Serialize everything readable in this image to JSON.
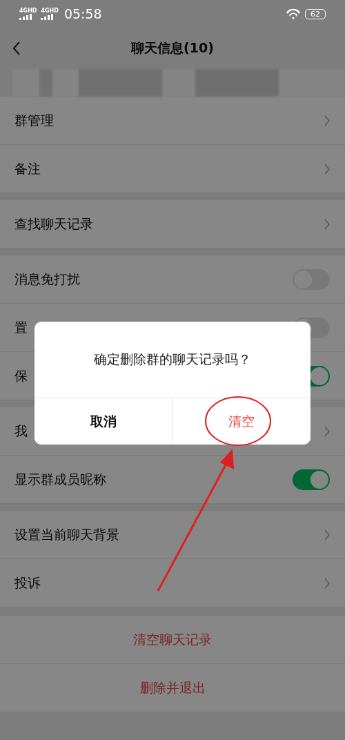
{
  "status_bar": {
    "signals": [
      {
        "label": "4GHD"
      },
      {
        "label": "4GHD"
      }
    ],
    "time": "05:58",
    "battery": "62"
  },
  "nav": {
    "title": "聊天信息(10)"
  },
  "sections": [
    [
      {
        "kind": "link",
        "label": "群管理"
      },
      {
        "kind": "link",
        "label": "备注"
      }
    ],
    [
      {
        "kind": "link",
        "label": "查找聊天记录"
      }
    ],
    [
      {
        "kind": "toggle",
        "label": "消息免打扰",
        "on": false
      },
      {
        "kind": "toggle",
        "label": "置",
        "on": false
      },
      {
        "kind": "toggle",
        "label": "保",
        "on": true
      }
    ],
    [
      {
        "kind": "link",
        "label": "我"
      },
      {
        "kind": "toggle",
        "label": "显示群成员昵称",
        "on": true
      }
    ],
    [
      {
        "kind": "link",
        "label": "设置当前聊天背景"
      },
      {
        "kind": "link",
        "label": "投诉"
      }
    ]
  ],
  "actions": [
    "清空聊天记录",
    "删除并退出"
  ],
  "dialog": {
    "message": "确定删除群的聊天记录吗？",
    "buttons": [
      {
        "label": "取消",
        "kind": "normal"
      },
      {
        "label": "清空",
        "kind": "danger"
      }
    ]
  }
}
